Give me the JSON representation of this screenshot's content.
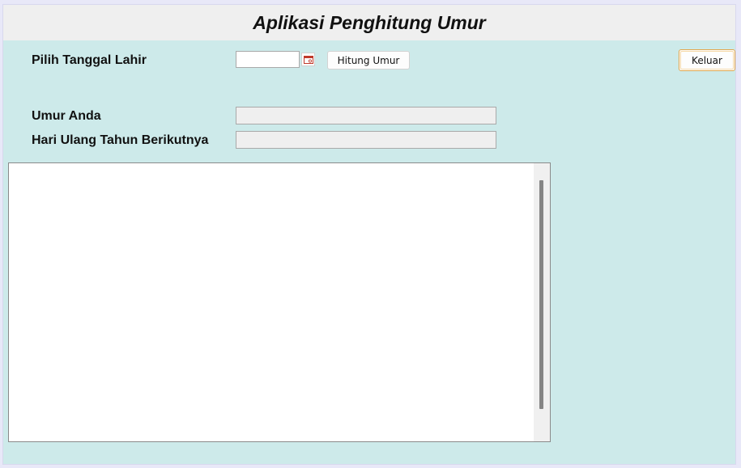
{
  "app": {
    "title": "Aplikasi Penghitung Umur"
  },
  "form": {
    "birthdate_label": "Pilih Tanggal Lahir",
    "birthdate_value": "",
    "calculate_button": "Hitung Umur",
    "exit_button": "Keluar",
    "age_label": "Umur Anda",
    "age_value": "",
    "next_birthday_label": "Hari Ulang Tahun Berikutnya",
    "next_birthday_value": ""
  },
  "output": {
    "text": ""
  },
  "icons": {
    "calendar": "calendar-icon"
  },
  "colors": {
    "panel_background": "#cdeaea",
    "title_background": "#efefef",
    "exit_button_border": "#e2a64a",
    "calendar_icon": "#c0392b"
  }
}
